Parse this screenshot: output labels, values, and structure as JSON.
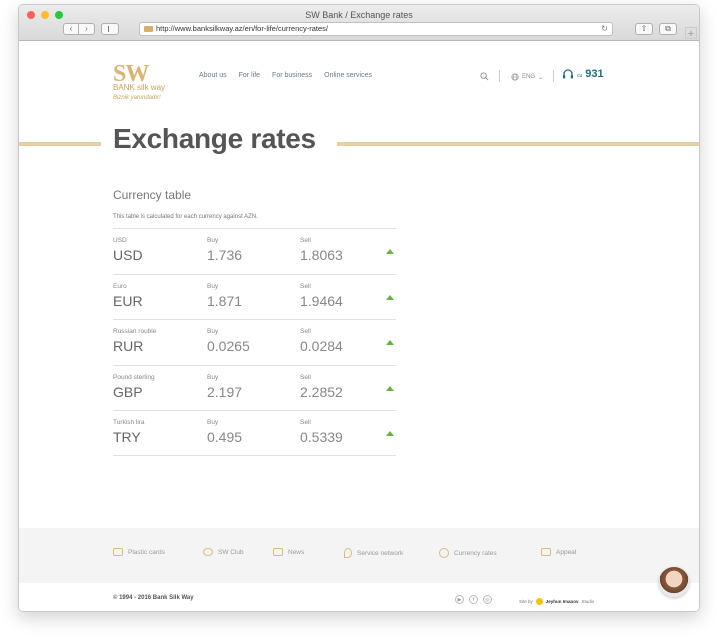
{
  "window": {
    "title": "SW Bank / Exchange rates",
    "url": "http://www.banksilkway.az/en/for-life/currency-rates/"
  },
  "header": {
    "logo": {
      "main": "SW",
      "bank": "BANK silk way",
      "tagline": "Biznik yanındadır!"
    },
    "nav": [
      "About us",
      "For life",
      "For business",
      "Online services"
    ],
    "lang": "ENG",
    "phone_label": "cu",
    "phone_number": "931"
  },
  "page": {
    "title": "Exchange rates",
    "section_title": "Currency table",
    "note": "This table is calculated for each currency against AZN.",
    "buy_label": "Buy",
    "sell_label": "Sell",
    "rates": [
      {
        "name": "USD",
        "code": "USD",
        "buy": "1.736",
        "sell": "1.8063",
        "trend": "up"
      },
      {
        "name": "Euro",
        "code": "EUR",
        "buy": "1.871",
        "sell": "1.9464",
        "trend": "up"
      },
      {
        "name": "Russian rouble",
        "code": "RUR",
        "buy": "0.0265",
        "sell": "0.0284",
        "trend": "up"
      },
      {
        "name": "Pound sterling",
        "code": "GBP",
        "buy": "2.197",
        "sell": "2.2852",
        "trend": "up"
      },
      {
        "name": "Turkish lira",
        "code": "TRY",
        "buy": "0.495",
        "sell": "0.5339",
        "trend": "up"
      }
    ]
  },
  "footer": {
    "links": [
      "Plastic cards",
      "SW Club",
      "News",
      "Service network",
      "Currency rates",
      "Appeal"
    ],
    "copyright": "© 1994 - 2016 Bank Silk Way",
    "credit_prefix": "Site by",
    "credit_name": "Jeyhun Imanov",
    "credit_suffix": "Studio"
  },
  "colors": {
    "gold": "#d9b56f",
    "accent_teal": "#1a6e7a",
    "up_green": "#6cb33e"
  }
}
